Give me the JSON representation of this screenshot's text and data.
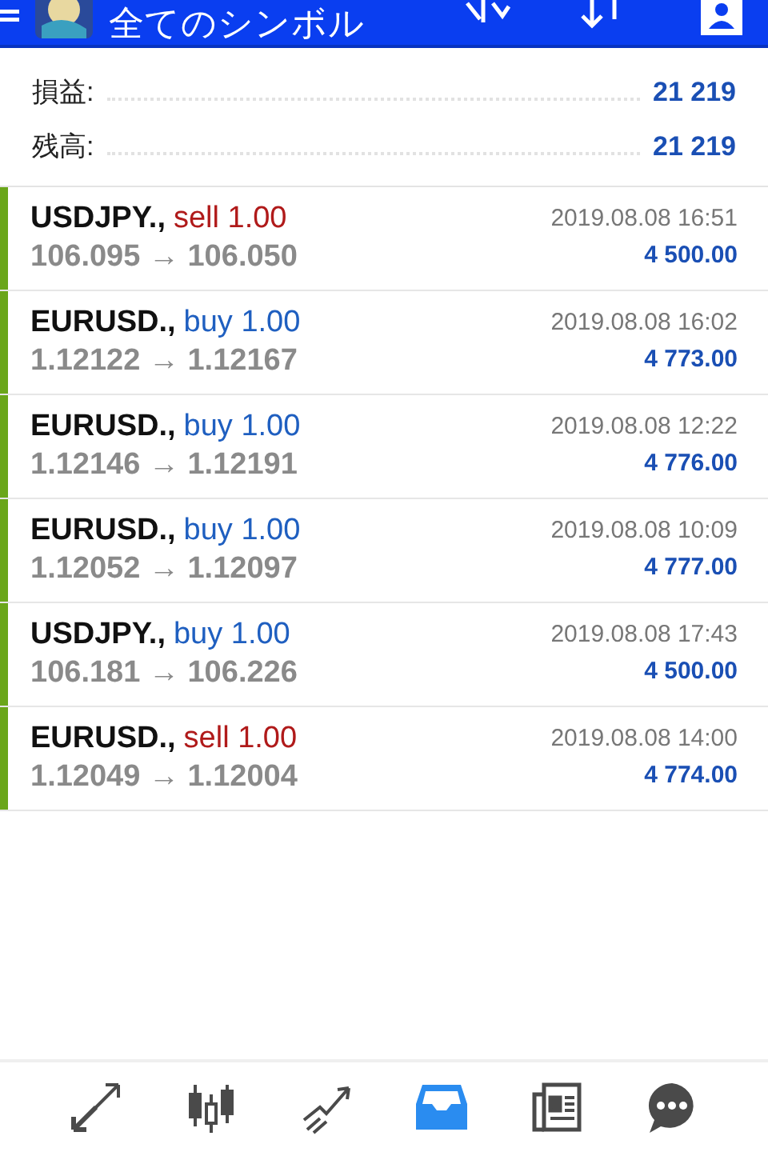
{
  "header": {
    "title": "全てのシンボル"
  },
  "summary": [
    {
      "label": "損益:",
      "value": "21 219"
    },
    {
      "label": "残高:",
      "value": "21 219"
    }
  ],
  "trades": [
    {
      "symbol": "USDJPY.,",
      "kind": "sell",
      "order": "sell 1.00",
      "prices": "106.095 → 106.050",
      "time": "2019.08.08 16:51",
      "profit": "4 500.00"
    },
    {
      "symbol": "EURUSD.,",
      "kind": "buy",
      "order": "buy 1.00",
      "prices": "1.12122 → 1.12167",
      "time": "2019.08.08 16:02",
      "profit": "4 773.00"
    },
    {
      "symbol": "EURUSD.,",
      "kind": "buy",
      "order": "buy 1.00",
      "prices": "1.12146 → 1.12191",
      "time": "2019.08.08 12:22",
      "profit": "4 776.00"
    },
    {
      "symbol": "EURUSD.,",
      "kind": "buy",
      "order": "buy 1.00",
      "prices": "1.12052 → 1.12097",
      "time": "2019.08.08 10:09",
      "profit": "4 777.00"
    },
    {
      "symbol": "USDJPY.,",
      "kind": "buy",
      "order": "buy 1.00",
      "prices": "106.181 → 106.226",
      "time": "2019.08.08 17:43",
      "profit": "4 500.00"
    },
    {
      "symbol": "EURUSD.,",
      "kind": "sell",
      "order": "sell 1.00",
      "prices": "1.12049 → 1.12004",
      "time": "2019.08.08 14:00",
      "profit": "4 774.00"
    }
  ],
  "nav": [
    {
      "kind": "quotes",
      "selected": false
    },
    {
      "kind": "chart",
      "selected": false
    },
    {
      "kind": "trade",
      "selected": false
    },
    {
      "kind": "history",
      "selected": true
    },
    {
      "kind": "news",
      "selected": false
    },
    {
      "kind": "chat",
      "selected": false
    }
  ]
}
